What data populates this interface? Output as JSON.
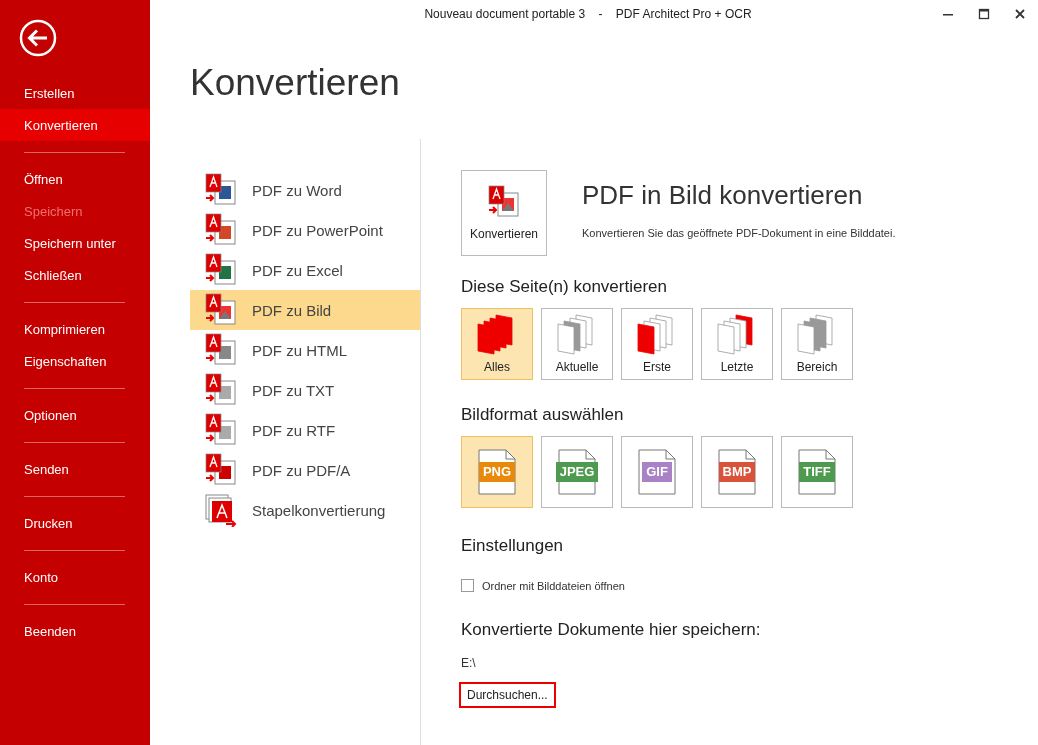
{
  "window": {
    "title": "Nouveau document portable 3    -    PDF Architect Pro + OCR"
  },
  "sidebar": {
    "groups": [
      {
        "items": [
          {
            "label": "Erstellen",
            "selected": false,
            "disabled": false
          },
          {
            "label": "Konvertieren",
            "selected": true,
            "disabled": false
          }
        ]
      },
      {
        "items": [
          {
            "label": "Öffnen",
            "selected": false,
            "disabled": false
          },
          {
            "label": "Speichern",
            "selected": false,
            "disabled": true
          },
          {
            "label": "Speichern unter",
            "selected": false,
            "disabled": false
          },
          {
            "label": "Schließen",
            "selected": false,
            "disabled": false
          }
        ]
      },
      {
        "items": [
          {
            "label": "Komprimieren",
            "selected": false,
            "disabled": false
          },
          {
            "label": "Eigenschaften",
            "selected": false,
            "disabled": false
          }
        ]
      },
      {
        "items": [
          {
            "label": "Optionen",
            "selected": false,
            "disabled": false
          }
        ]
      },
      {
        "items": [
          {
            "label": "Senden",
            "selected": false,
            "disabled": false
          }
        ]
      },
      {
        "items": [
          {
            "label": "Drucken",
            "selected": false,
            "disabled": false
          }
        ]
      },
      {
        "items": [
          {
            "label": "Konto",
            "selected": false,
            "disabled": false
          }
        ]
      },
      {
        "items": [
          {
            "label": "Beenden",
            "selected": false,
            "disabled": false
          }
        ]
      }
    ]
  },
  "heading": "Konvertieren",
  "conversions": [
    {
      "label": "PDF zu Word",
      "kind": "word",
      "selected": false
    },
    {
      "label": "PDF zu PowerPoint",
      "kind": "powerpoint",
      "selected": false
    },
    {
      "label": "PDF zu Excel",
      "kind": "excel",
      "selected": false
    },
    {
      "label": "PDF zu Bild",
      "kind": "image",
      "selected": true
    },
    {
      "label": "PDF zu HTML",
      "kind": "html",
      "selected": false
    },
    {
      "label": "PDF zu TXT",
      "kind": "txt",
      "selected": false
    },
    {
      "label": "PDF zu RTF",
      "kind": "rtf",
      "selected": false
    },
    {
      "label": "PDF zu PDF/A",
      "kind": "pdfa",
      "selected": false
    },
    {
      "label": "Stapelkonvertierung",
      "kind": "batch",
      "selected": false
    }
  ],
  "panel": {
    "convert_button": "Konvertieren",
    "title": "PDF in Bild konvertieren",
    "description": "Konvertieren Sie das geöffnete PDF-Dokument in eine Bilddatei.",
    "pages": {
      "heading": "Diese Seite(n) konvertieren",
      "options": [
        {
          "label": "Alles",
          "kind": "all",
          "selected": true
        },
        {
          "label": "Aktuelle",
          "kind": "current",
          "selected": false
        },
        {
          "label": "Erste",
          "kind": "first",
          "selected": false
        },
        {
          "label": "Letzte",
          "kind": "last",
          "selected": false
        },
        {
          "label": "Bereich",
          "kind": "range",
          "selected": false
        }
      ]
    },
    "image_format": {
      "heading": "Bildformat auswählen",
      "options": [
        {
          "label": "PNG",
          "color": "#e8890c",
          "selected": true
        },
        {
          "label": "JPEG",
          "color": "#4e9a4e",
          "selected": false
        },
        {
          "label": "GIF",
          "color": "#a982c6",
          "selected": false
        },
        {
          "label": "BMP",
          "color": "#d9533a",
          "selected": false
        },
        {
          "label": "TIFF",
          "color": "#4e9a4e",
          "selected": false
        }
      ]
    },
    "settings": {
      "heading": "Einstellungen",
      "checkbox": {
        "label": "Ordner mit Bilddateien öffnen",
        "checked": false
      }
    },
    "save": {
      "heading": "Konvertierte Dokumente hier speichern:",
      "path": "E:\\",
      "browse_button": "Durchsuchen...",
      "highlighted": true
    }
  }
}
